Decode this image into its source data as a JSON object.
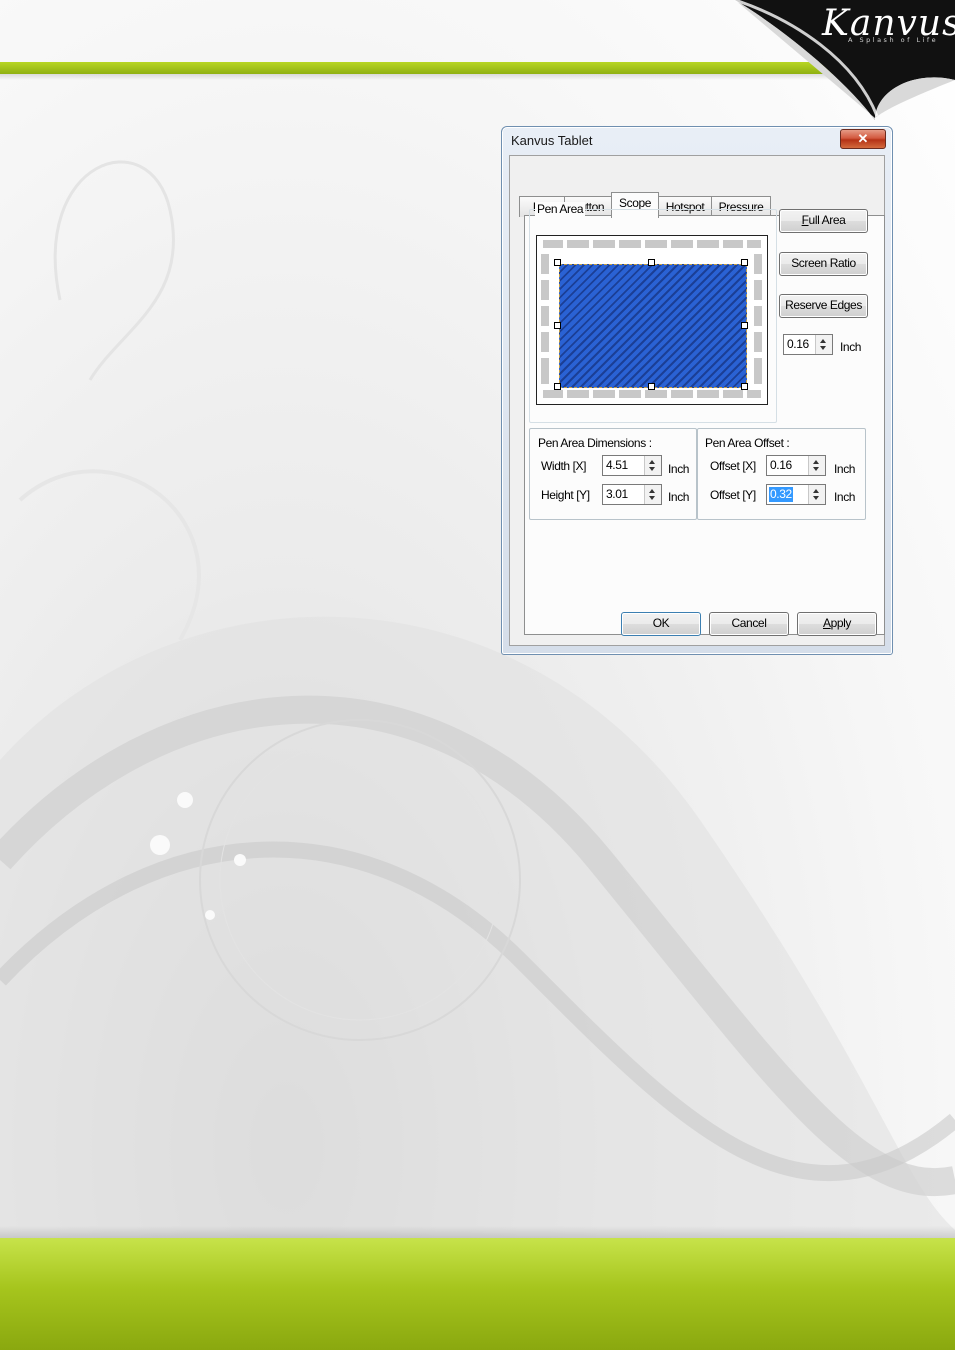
{
  "brand": {
    "logo_text": "Kanvus",
    "tagline": "A Splash of Life"
  },
  "dialog": {
    "title": "Kanvus Tablet",
    "close_symbol": "✕",
    "tabs": [
      {
        "label": "Info",
        "active": false
      },
      {
        "label": "Button",
        "active": false
      },
      {
        "label": "Scope",
        "active": true
      },
      {
        "label": "Hotspot",
        "active": false
      },
      {
        "label": "Pressure",
        "active": false
      }
    ],
    "pen_area": {
      "group_title": "Pen Area",
      "full_area_label": "Full Area",
      "full_area_mnemonic": "F",
      "screen_ratio_label": "Screen Ratio",
      "reserve_edges_label": "Reserve Edges",
      "reserve_value": "0.16",
      "reserve_unit": "Inch"
    },
    "dimensions": {
      "group_title": "Pen Area Dimensions :",
      "width_label": "Width [X]",
      "width_value": "4.51",
      "height_label": "Height [Y]",
      "height_value": "3.01",
      "unit": "Inch"
    },
    "offset": {
      "group_title": "Pen Area Offset :",
      "x_label": "Offset [X]",
      "x_value": "0.16",
      "y_label": "Offset [Y]",
      "y_value": "0.32",
      "unit": "Inch"
    },
    "footer": {
      "ok_label": "OK",
      "cancel_label": "Cancel",
      "apply_label": "Apply",
      "apply_mnemonic": "A"
    }
  },
  "colors": {
    "accent_green": "#a6c51d",
    "pen_area_fill": "#2a62d4",
    "close_button": "#c8432a",
    "selection": "#3399ff"
  }
}
